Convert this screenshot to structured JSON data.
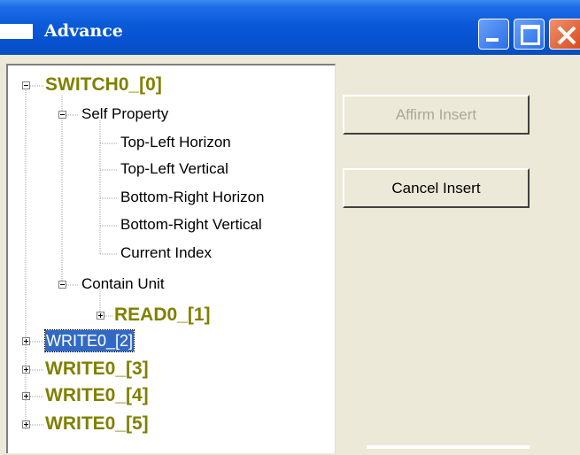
{
  "window": {
    "title": "Advance"
  },
  "tree": {
    "root": "SWITCH0_[0]",
    "self_property": "Self Property",
    "properties": [
      "Top-Left Horizon",
      "Top-Left Vertical",
      "Bottom-Right Horizon",
      "Bottom-Right Vertical",
      "Current Index"
    ],
    "contain_unit": "Contain Unit",
    "child": "READ0_[1]",
    "siblings": [
      "WRITE0_[2]",
      "WRITE0_[3]",
      "WRITE0_[4]",
      "WRITE0_[5]"
    ],
    "selected": "WRITE0_[2]"
  },
  "buttons": {
    "affirm": "Affirm Insert",
    "cancel": "Cancel Insert"
  },
  "colors": {
    "title_bar": "#0a5ad8",
    "node_text": "#808000",
    "selection": "#316ac5"
  }
}
